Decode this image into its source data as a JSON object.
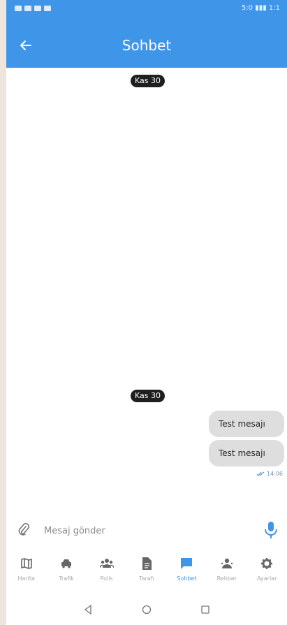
{
  "status_bar": {
    "right_text": "5:0 ▮▮▮ 1:1"
  },
  "header": {
    "title": "Sohbet"
  },
  "chat": {
    "date_chips": [
      "Kas 30",
      "Kas 30"
    ],
    "messages": [
      {
        "text": "Test mesajı"
      },
      {
        "text": "Test mesajı",
        "time": "14:06"
      }
    ]
  },
  "composer": {
    "placeholder": "Mesaj gönder"
  },
  "bottom_nav": {
    "items": [
      {
        "label": "Harita",
        "icon": "map-icon"
      },
      {
        "label": "Trafik",
        "icon": "car-icon"
      },
      {
        "label": "Polis",
        "icon": "group-icon"
      },
      {
        "label": "Tarafı",
        "icon": "document-icon"
      },
      {
        "label": "Sohbet",
        "icon": "chat-icon",
        "active": true
      },
      {
        "label": "Rehber",
        "icon": "person-icon"
      },
      {
        "label": "Ayarlar",
        "icon": "gear-icon"
      }
    ]
  },
  "colors": {
    "primary": "#3f95e8",
    "bubble": "#dedede"
  }
}
